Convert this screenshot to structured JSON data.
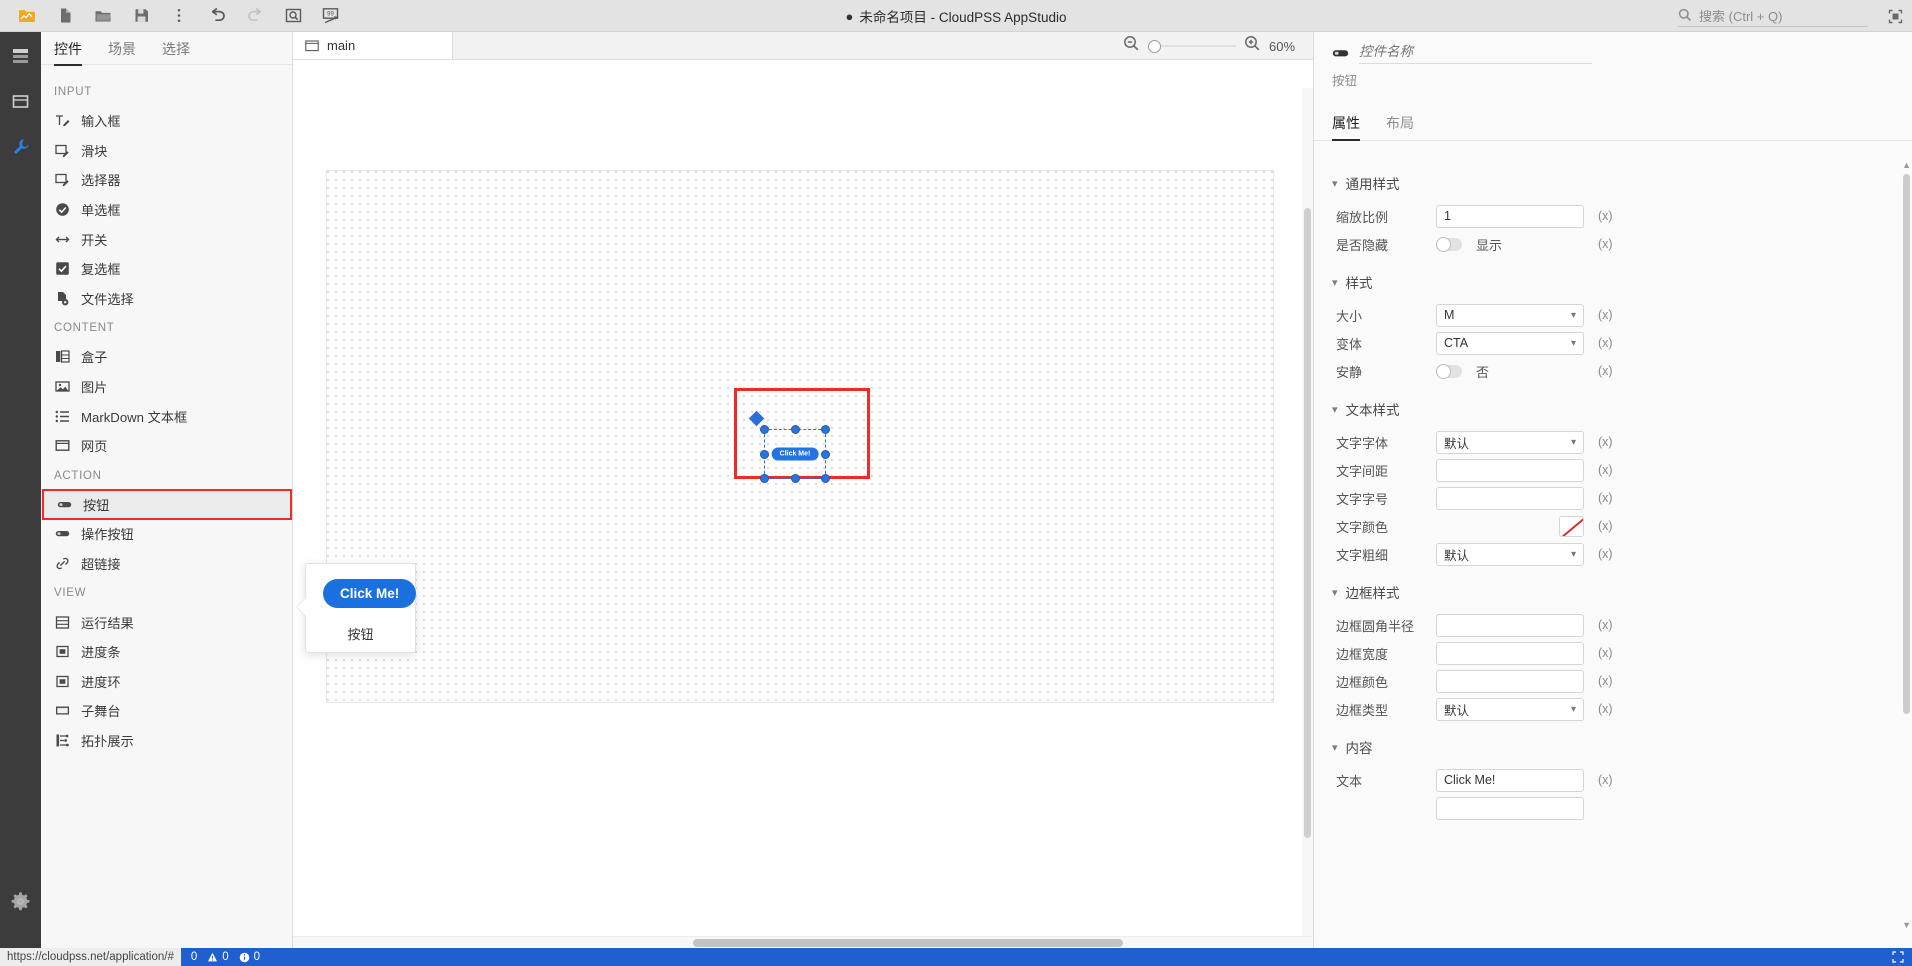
{
  "titlebar": {
    "dot": "●",
    "title": "未命名项目 - CloudPSS AppStudio",
    "icons": [
      {
        "name": "app-logo-icon",
        "label": "logo"
      },
      {
        "name": "new-file-icon",
        "label": "新建"
      },
      {
        "name": "open-folder-icon",
        "label": "打开"
      },
      {
        "name": "save-icon",
        "label": "保存"
      },
      {
        "name": "more-vertical-icon",
        "label": "更多"
      },
      {
        "name": "undo-icon",
        "label": "撤销"
      },
      {
        "name": "redo-icon",
        "label": "重做"
      },
      {
        "name": "preview-icon",
        "label": "预览"
      },
      {
        "name": "run-icon",
        "label": "运行"
      }
    ],
    "search_placeholder": "搜索 (Ctrl + Q)",
    "search_value": "",
    "search_icon": "search-icon",
    "fullscreen_icon": "fullscreen-icon"
  },
  "rail": {
    "items": [
      {
        "name": "rail-item-layers",
        "icon": "layers-icon",
        "active": false
      },
      {
        "name": "rail-item-box",
        "icon": "box-icon",
        "active": false
      },
      {
        "name": "rail-item-tools",
        "icon": "wrench-icon",
        "active": true
      }
    ],
    "settings_icon": "gear-icon"
  },
  "left_panel": {
    "tabs": [
      {
        "label": "控件",
        "active": true
      },
      {
        "label": "场景",
        "active": false
      },
      {
        "label": "选择",
        "active": false
      }
    ],
    "groups": [
      {
        "title": "INPUT",
        "items": [
          {
            "label": "输入框",
            "icon": "text-input-icon"
          },
          {
            "label": "滑块",
            "icon": "slider-icon"
          },
          {
            "label": "选择器",
            "icon": "select-icon"
          },
          {
            "label": "单选框",
            "icon": "radio-icon"
          },
          {
            "label": "开关",
            "icon": "switch-icon"
          },
          {
            "label": "复选框",
            "icon": "checkbox-icon"
          },
          {
            "label": "文件选择",
            "icon": "file-picker-icon"
          }
        ]
      },
      {
        "title": "CONTENT",
        "items": [
          {
            "label": "盒子",
            "icon": "box-layout-icon"
          },
          {
            "label": "图片",
            "icon": "image-icon"
          },
          {
            "label": "MarkDown 文本框",
            "icon": "markdown-icon"
          },
          {
            "label": "网页",
            "icon": "webpage-icon"
          }
        ]
      },
      {
        "title": "ACTION",
        "items": [
          {
            "label": "按钮",
            "icon": "button-icon",
            "selected": true
          },
          {
            "label": "操作按钮",
            "icon": "button-icon"
          },
          {
            "label": "超链接",
            "icon": "link-icon"
          }
        ]
      },
      {
        "title": "VIEW",
        "items": [
          {
            "label": "运行结果",
            "icon": "result-table-icon"
          },
          {
            "label": "进度条",
            "icon": "progress-bar-icon"
          },
          {
            "label": "进度环",
            "icon": "progress-ring-icon"
          },
          {
            "label": "子舞台",
            "icon": "sub-stage-icon"
          },
          {
            "label": "拓扑展示",
            "icon": "topology-icon"
          }
        ]
      }
    ]
  },
  "center": {
    "tab": {
      "label": "main",
      "icon": "window-icon"
    },
    "zoom": {
      "out_icon": "zoom-out-icon",
      "in_icon": "zoom-in-icon",
      "percent": "60%"
    },
    "selected_widget": {
      "label": "Click Me!"
    }
  },
  "popup": {
    "button_label": "Click Me!",
    "caption": "按钮"
  },
  "right_panel": {
    "name_icon": "button-icon",
    "name_placeholder": "控件名称",
    "name_value": "",
    "subtitle": "按钮",
    "tabs": [
      {
        "label": "属性",
        "active": true
      },
      {
        "label": "布局",
        "active": false
      }
    ],
    "expr_marker": "(x)",
    "sections": [
      {
        "title": "通用样式",
        "rows": [
          {
            "label": "缩放比例",
            "type": "input",
            "value": "1",
            "name": "scale-ratio"
          },
          {
            "label": "是否隐藏",
            "type": "toggle",
            "value": "显示",
            "on": false,
            "name": "hidden-toggle"
          }
        ]
      },
      {
        "title": "样式",
        "rows": [
          {
            "label": "大小",
            "type": "select",
            "value": "M",
            "name": "size-select"
          },
          {
            "label": "变体",
            "type": "select",
            "value": "CTA",
            "name": "variant-select"
          },
          {
            "label": "安静",
            "type": "toggle",
            "value": "否",
            "on": false,
            "name": "quiet-toggle"
          }
        ]
      },
      {
        "title": "文本样式",
        "rows": [
          {
            "label": "文字字体",
            "type": "select",
            "value": "默认",
            "name": "font-family-select"
          },
          {
            "label": "文字间距",
            "type": "input",
            "value": "",
            "name": "letter-spacing-input"
          },
          {
            "label": "文字字号",
            "type": "input",
            "value": "",
            "name": "font-size-input"
          },
          {
            "label": "文字颜色",
            "type": "color",
            "value": "",
            "name": "font-color-swatch"
          },
          {
            "label": "文字粗细",
            "type": "select",
            "value": "默认",
            "name": "font-weight-select"
          }
        ]
      },
      {
        "title": "边框样式",
        "rows": [
          {
            "label": "边框圆角半径",
            "type": "input",
            "value": "",
            "name": "border-radius-input"
          },
          {
            "label": "边框宽度",
            "type": "input",
            "value": "",
            "name": "border-width-input"
          },
          {
            "label": "边框颜色",
            "type": "input",
            "value": "",
            "name": "border-color-input"
          },
          {
            "label": "边框类型",
            "type": "select",
            "value": "默认",
            "name": "border-style-select"
          }
        ]
      },
      {
        "title": "内容",
        "rows": [
          {
            "label": "文本",
            "type": "input",
            "value": "Click Me!",
            "name": "content-text-input"
          }
        ]
      }
    ]
  },
  "statusbar": {
    "url": "https://cloudpss.net/application/#",
    "warn_icon": "warning-icon",
    "warn_count": "0",
    "info_icon": "info-icon",
    "info_count": "0",
    "left_count": "0",
    "right_icon": "expand-icon"
  },
  "colors": {
    "accent_blue": "#1b70e0",
    "selection_red": "#ee2b26",
    "handle_blue": "#2b73d6",
    "titlebar_bg": "#e3e3e3",
    "rail_bg": "#3c3c3c",
    "status_bg": "#1f5fd0"
  }
}
